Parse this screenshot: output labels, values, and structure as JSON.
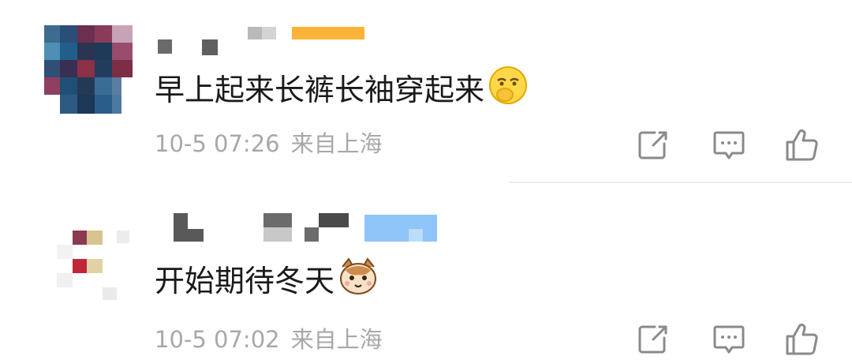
{
  "comments": [
    {
      "text": "早上起来长裤长袖穿起来",
      "emoji_icon": "shy-face-emoji",
      "date": "10-5 07:26",
      "location": "来自上海"
    },
    {
      "text": "开始期待冬天",
      "emoji_icon": "cat-face-emoji",
      "date": "10-5 07:02",
      "location": "来自上海"
    }
  ],
  "icons": {
    "share": "share-icon",
    "reply": "reply-icon",
    "like": "like-icon"
  },
  "colors": {
    "text": "#1a1a1a",
    "meta": "#a8a8a8",
    "icon": "#8a8a8a",
    "badge_orange": "#fbb338",
    "badge_blue": "#8fc4f8"
  }
}
